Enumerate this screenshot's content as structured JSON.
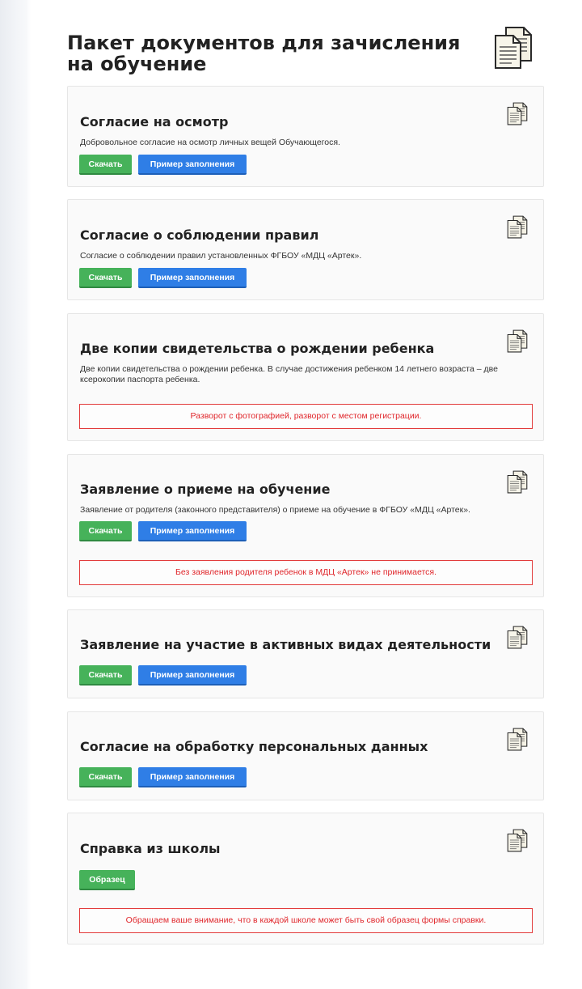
{
  "page": {
    "title": "Пакет документов для зачисления на обучение"
  },
  "colors": {
    "download": "#46b25a",
    "example": "#2f7ee6",
    "notice": "#e0262b"
  },
  "documents": [
    {
      "title": "Согласие на осмотр",
      "description": "Добровольное согласие на осмотр личных вещей Обучающегося.",
      "download_label": "Скачать",
      "example_label": "Пример заполнения",
      "icon": "document-copy-icon"
    },
    {
      "title": "Согласие о соблюдении правил",
      "description": "Согласие о соблюдении правил установленных ФГБОУ «МДЦ «Артек».",
      "download_label": "Скачать",
      "example_label": "Пример заполнения",
      "icon": "document-copy-icon"
    },
    {
      "title": "Две копии свидетельства о рождении ребенка",
      "description": "Две копии свидетельства о рождении ребенка. В случае достижения ребенком 14 летнего возраста – две ксерокопии паспорта ребенка.",
      "notice": "Разворот с фотографией, разворот с местом регистрации.",
      "icon": "document-copy-icon"
    },
    {
      "title": "Заявление о приеме на обучение",
      "description": "Заявление от родителя (законного представителя) о приеме на обучение в ФГБОУ «МДЦ «Артек».",
      "download_label": "Скачать",
      "example_label": "Пример заполнения",
      "notice": "Без заявления родителя ребенок в МДЦ «Артек» не принимается.",
      "icon": "document-copy-icon"
    },
    {
      "title": "Заявление на участие в активных видах деятельности",
      "download_label": "Скачать",
      "example_label": "Пример заполнения",
      "icon": "document-copy-icon"
    },
    {
      "title": "Согласие на обработку персональных данных",
      "download_label": "Скачать",
      "example_label": "Пример заполнения",
      "icon": "document-copy-icon"
    },
    {
      "title": "Справка из школы",
      "sample_label": "Образец",
      "notice": "Обращаем ваше внимание, что в каждой школе может быть свой образец формы справки.",
      "icon": "document-copy-icon"
    }
  ]
}
